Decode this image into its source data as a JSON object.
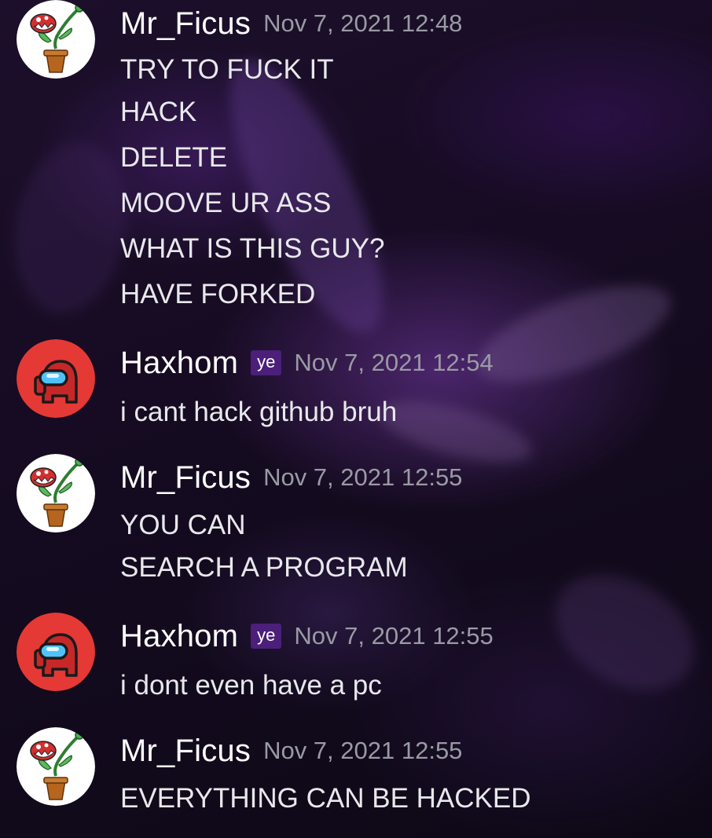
{
  "theme": {
    "accent_tag_bg": "#4b1f7a",
    "username_color": "#ffffff",
    "timestamp_color": "#9a9aa4",
    "text_color": "#e8e8ec"
  },
  "messages": [
    {
      "author": "Mr_Ficus",
      "avatar_icon": "piranha-plant-avatar-icon",
      "timestamp": "Nov 7, 2021 12:48",
      "lines": [
        "TRY TO FUCK IT",
        "HACK",
        "DELETE",
        "MOOVE UR ASS",
        "WHAT IS THIS GUY?",
        "HAVE FORKED"
      ]
    },
    {
      "author": "Haxhom",
      "tag": "ye",
      "avatar_icon": "among-us-crewmate-avatar-icon",
      "timestamp": "Nov 7, 2021 12:54",
      "lines": [
        "i cant hack github bruh"
      ]
    },
    {
      "author": "Mr_Ficus",
      "avatar_icon": "piranha-plant-avatar-icon",
      "timestamp": "Nov 7, 2021 12:55",
      "lines": [
        "YOU CAN",
        "SEARCH A PROGRAM"
      ]
    },
    {
      "author": "Haxhom",
      "tag": "ye",
      "avatar_icon": "among-us-crewmate-avatar-icon",
      "timestamp": "Nov 7, 2021 12:55",
      "lines": [
        "i dont even have a pc"
      ]
    },
    {
      "author": "Mr_Ficus",
      "avatar_icon": "piranha-plant-avatar-icon",
      "timestamp": "Nov 7, 2021 12:55",
      "lines": [
        "EVERYTHING CAN BE HACKED"
      ]
    }
  ]
}
